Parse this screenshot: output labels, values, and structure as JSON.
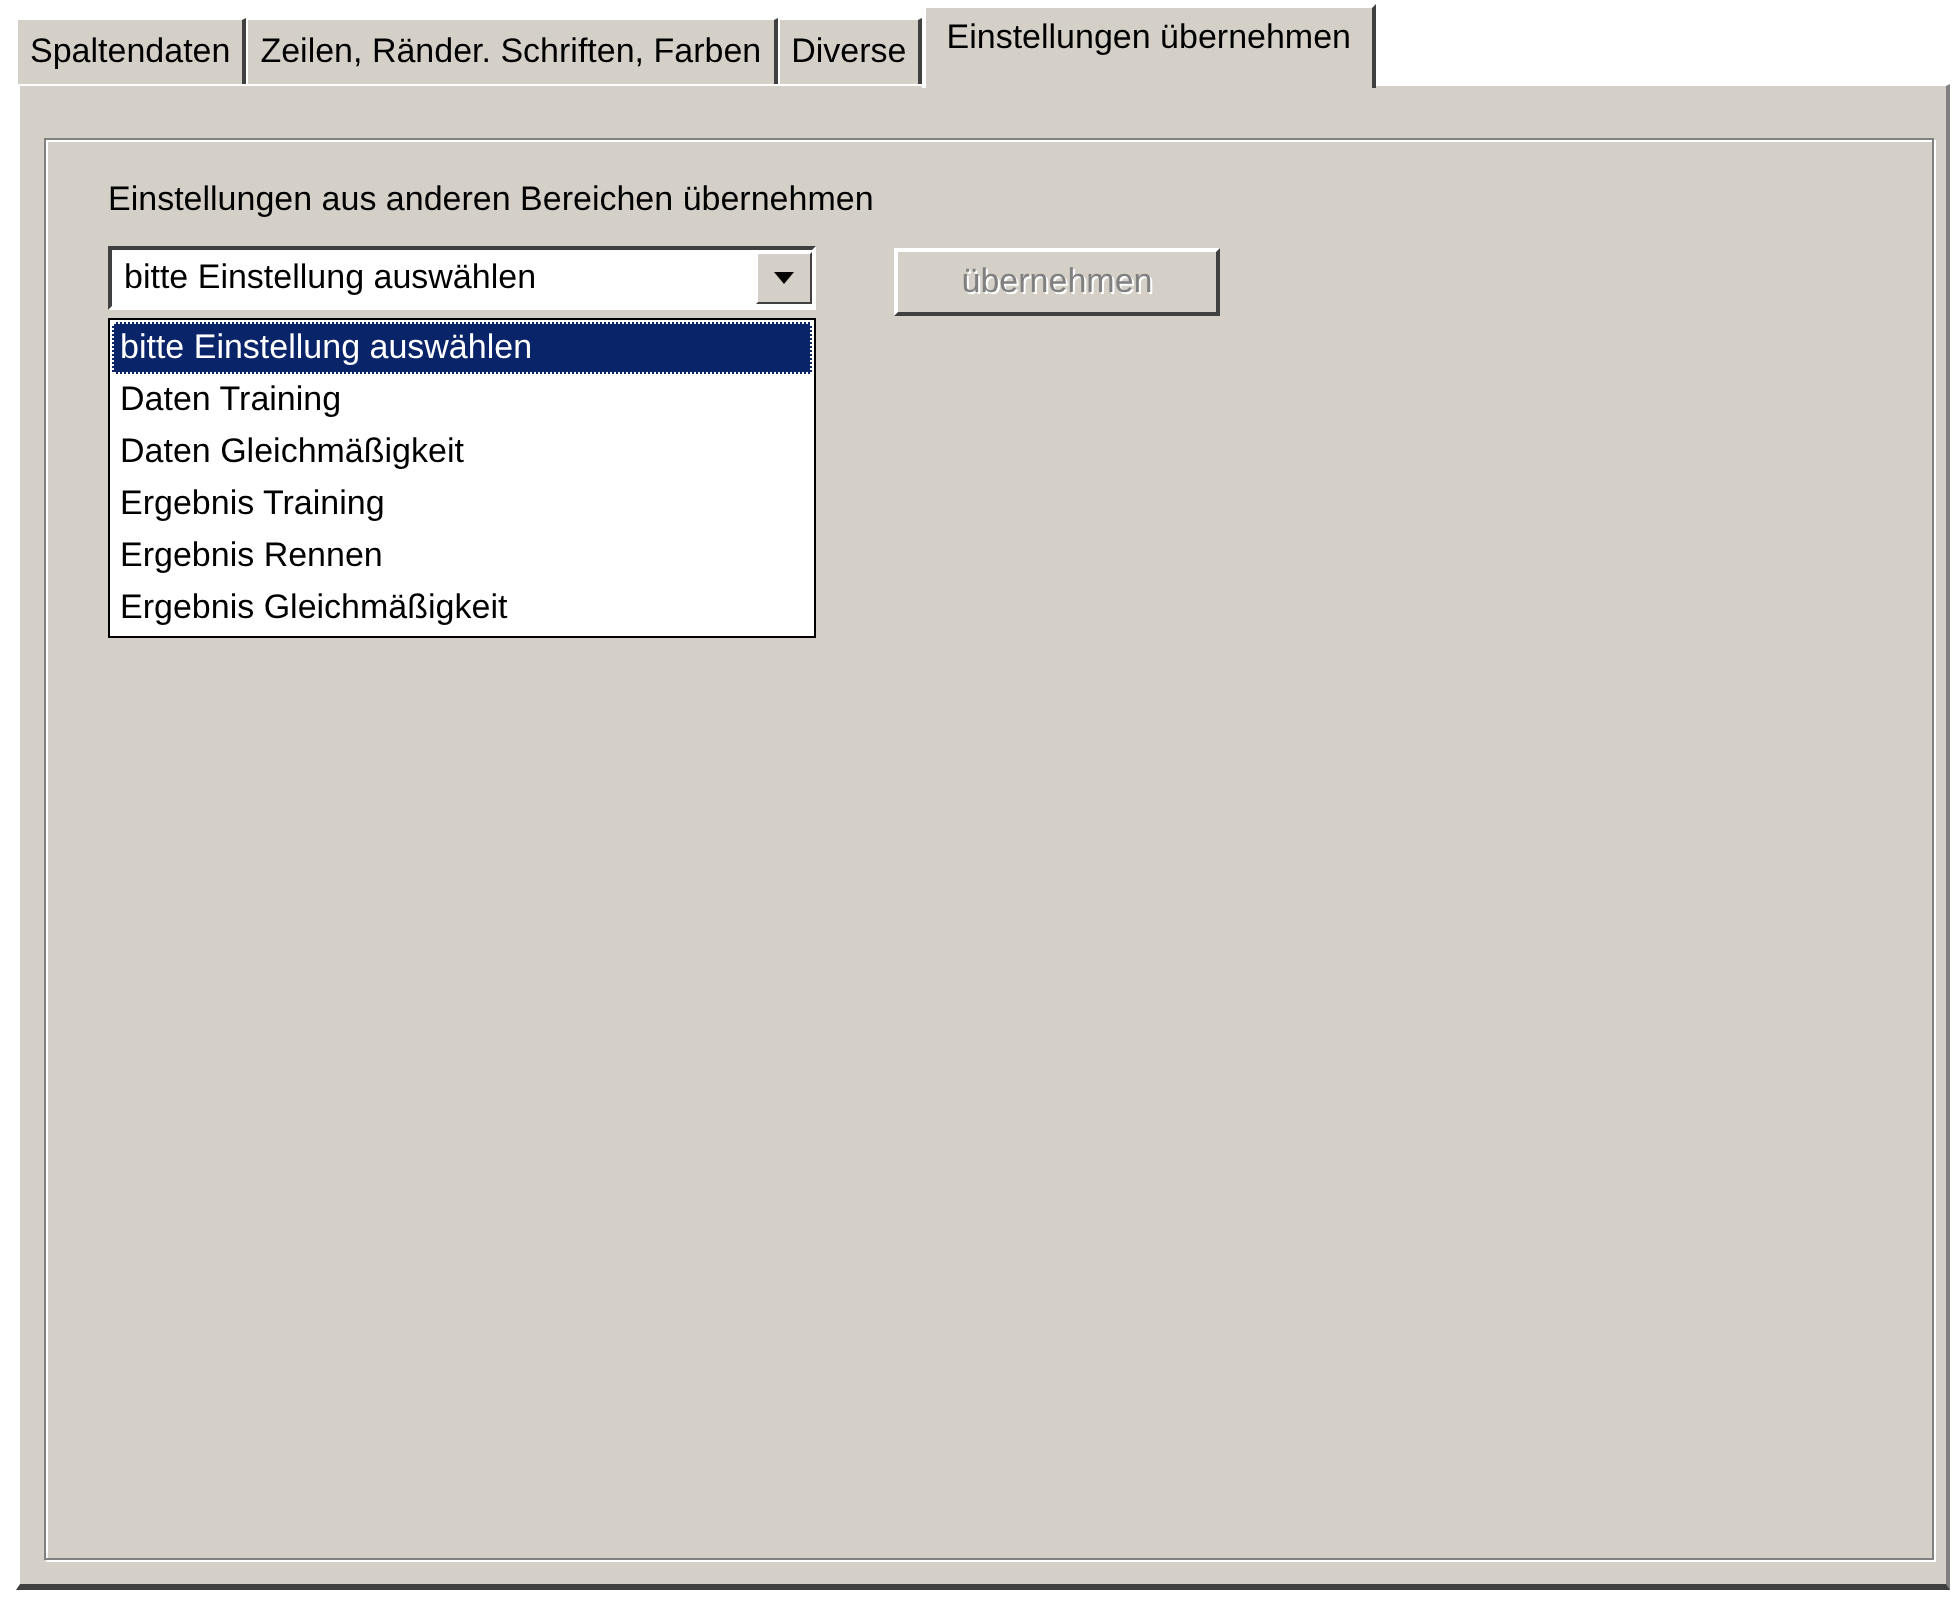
{
  "tabs": [
    {
      "label": "Spaltendaten",
      "selected": false
    },
    {
      "label": "Zeilen, Ränder. Schriften, Farben",
      "selected": false
    },
    {
      "label": "Diverse",
      "selected": false
    },
    {
      "label": "Einstellungen übernehmen",
      "selected": true
    }
  ],
  "group": {
    "label": "Einstellungen aus anderen Bereichen übernehmen",
    "combo": {
      "value": "bitte Einstellung auswählen",
      "expanded": true,
      "options": [
        {
          "label": "bitte Einstellung auswählen",
          "selected": true
        },
        {
          "label": "Daten Training",
          "selected": false
        },
        {
          "label": "Daten Gleichmäßigkeit",
          "selected": false
        },
        {
          "label": "Ergebnis Training",
          "selected": false
        },
        {
          "label": "Ergebnis Rennen",
          "selected": false
        },
        {
          "label": "Ergebnis Gleichmäßigkeit",
          "selected": false
        }
      ]
    },
    "button": {
      "label": "übernehmen",
      "disabled": true
    }
  }
}
